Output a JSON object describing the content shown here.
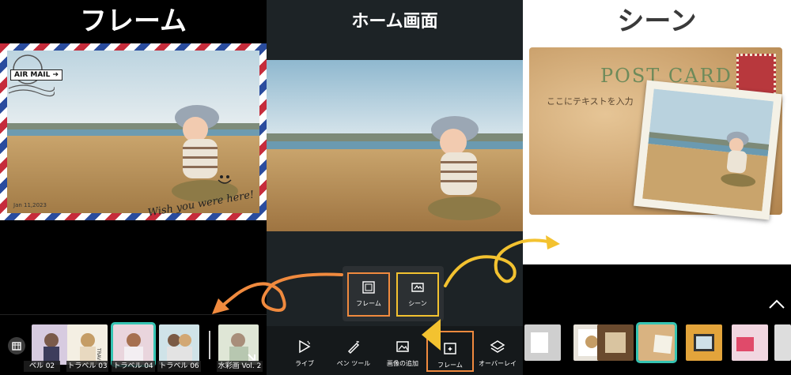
{
  "left": {
    "title": "フレーム",
    "stamp": "AIR MAIL ➔",
    "date": "Jan 11,2023",
    "wish": "Wish you were here!",
    "thumbs": [
      {
        "label": "ベル 02"
      },
      {
        "label": "トラベル 03"
      },
      {
        "label": "トラベル 04"
      },
      {
        "label": "トラベル 06"
      },
      {
        "label": "水彩画 Vol. 2"
      }
    ]
  },
  "center": {
    "title": "ホーム画面",
    "popup": [
      {
        "label": "フレーム",
        "color": "#f08a3e"
      },
      {
        "label": "シーン",
        "color": "#f3c230"
      }
    ],
    "tools": [
      {
        "label": "ライブ"
      },
      {
        "label": "ペン ツール"
      },
      {
        "label": "画像の追加"
      },
      {
        "label": "フレーム"
      },
      {
        "label": "オーバーレイ"
      }
    ]
  },
  "right": {
    "title": "シーン",
    "postcard_title": "POST CARD",
    "postcard_text": "ここにテキストを入力"
  },
  "colors": {
    "accent_orange": "#f08a3e",
    "accent_yellow": "#f3c230",
    "selection_teal": "#36c4b3"
  }
}
